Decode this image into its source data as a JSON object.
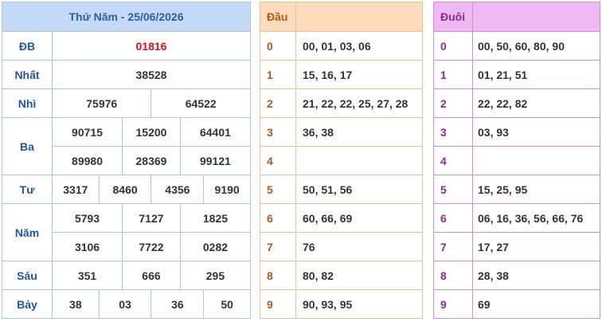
{
  "results": {
    "title": "Thứ Năm - 25/06/2026",
    "rows": [
      {
        "label": "ĐB",
        "numbers": [
          "01816"
        ]
      },
      {
        "label": "Nhất",
        "numbers": [
          "38528"
        ]
      },
      {
        "label": "Nhì",
        "numbers": [
          "75976",
          "64522"
        ]
      },
      {
        "label": "Ba",
        "numbers": [
          "90715",
          "15200",
          "64401",
          "89980",
          "28369",
          "99121"
        ]
      },
      {
        "label": "Tư",
        "numbers": [
          "3317",
          "8460",
          "4356",
          "9190"
        ]
      },
      {
        "label": "Năm",
        "numbers": [
          "5793",
          "7127",
          "1825",
          "3106",
          "7722",
          "0282"
        ]
      },
      {
        "label": "Sáu",
        "numbers": [
          "351",
          "666",
          "295"
        ]
      },
      {
        "label": "Bảy",
        "numbers": [
          "38",
          "03",
          "36",
          "50"
        ]
      }
    ]
  },
  "head": {
    "title": "Đầu",
    "rows": [
      {
        "key": "0",
        "values": "00, 01, 03, 06"
      },
      {
        "key": "1",
        "values": "15, 16, 17"
      },
      {
        "key": "2",
        "values": "21, 22, 22, 25, 27, 28"
      },
      {
        "key": "3",
        "values": "36, 38"
      },
      {
        "key": "4",
        "values": ""
      },
      {
        "key": "5",
        "values": "50, 51, 56"
      },
      {
        "key": "6",
        "values": "60, 66, 69"
      },
      {
        "key": "7",
        "values": "76"
      },
      {
        "key": "8",
        "values": "80, 82"
      },
      {
        "key": "9",
        "values": "90, 93, 95"
      }
    ]
  },
  "tail": {
    "title": "Đuôi",
    "rows": [
      {
        "key": "0",
        "values": "00, 50, 60, 80, 90"
      },
      {
        "key": "1",
        "values": "01, 21, 51"
      },
      {
        "key": "2",
        "values": "22, 22, 82"
      },
      {
        "key": "3",
        "values": "03, 93"
      },
      {
        "key": "4",
        "values": ""
      },
      {
        "key": "5",
        "values": "15, 25, 95"
      },
      {
        "key": "6",
        "values": "06, 16, 36, 56, 66, 76"
      },
      {
        "key": "7",
        "values": "17, 27"
      },
      {
        "key": "8",
        "values": "28, 38"
      },
      {
        "key": "9",
        "values": "69"
      }
    ]
  },
  "colors": {
    "results_header_bg": "#c5daf6",
    "head_header_bg": "#fddcbd",
    "tail_header_bg": "#eeb8f0",
    "special_prize": "#e0101a"
  }
}
